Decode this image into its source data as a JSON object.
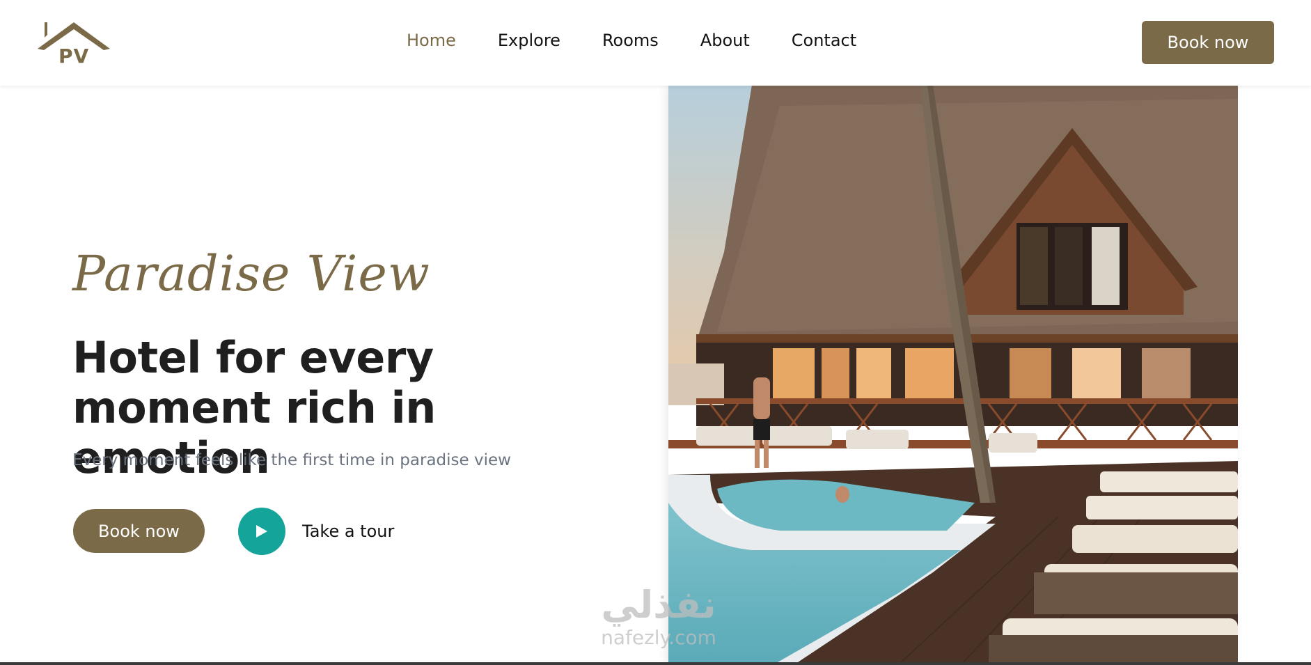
{
  "brand": {
    "logo_text": "PV",
    "color": "#7b6a48"
  },
  "nav": {
    "items": [
      {
        "label": "Home",
        "active": true
      },
      {
        "label": "Explore",
        "active": false
      },
      {
        "label": "Rooms",
        "active": false
      },
      {
        "label": "About",
        "active": false
      },
      {
        "label": "Contact",
        "active": false
      }
    ]
  },
  "header": {
    "cta_label": "Book now"
  },
  "hero": {
    "script_title": "Paradise View",
    "headline": "Hotel for every moment rich in emotion",
    "subtitle": "Every moment feels like the first time in paradise view",
    "book_label": "Book now",
    "tour_label": "Take a tour",
    "image_icon": "hotel-pool-photo"
  },
  "watermark": {
    "arabic": "نفذلي",
    "latin": "nafezly.com"
  },
  "colors": {
    "accent": "#7b6a48",
    "play": "#14a49a",
    "muted_text": "#6b7380"
  }
}
